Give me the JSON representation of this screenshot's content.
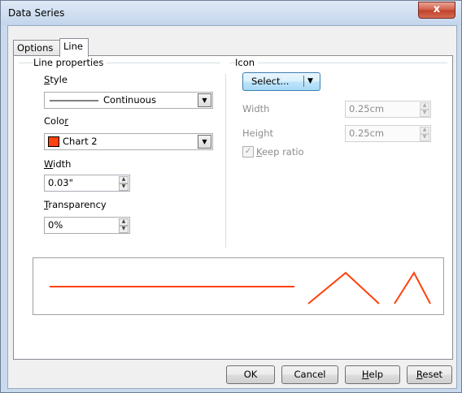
{
  "window": {
    "title": "Data Series",
    "close_label": "x"
  },
  "tabs": [
    {
      "label": "Options"
    },
    {
      "label": "Line"
    }
  ],
  "line_properties": {
    "group_label": "Line properties",
    "style": {
      "label": "Style",
      "value": "Continuous"
    },
    "color": {
      "label": "Color",
      "value": "Chart 2",
      "swatch": "#ff420e"
    },
    "width": {
      "label": "Width",
      "value": "0.03\""
    },
    "transparency": {
      "label": "Transparency",
      "value": "0%"
    }
  },
  "icon": {
    "group_label": "Icon",
    "select_label": "Select...",
    "width": {
      "label": "Width",
      "value": "0.25cm"
    },
    "height": {
      "label": "Height",
      "value": "0.25cm"
    },
    "keep_ratio": {
      "label": "Keep ratio",
      "checked": true
    }
  },
  "preview": {
    "line_color": "#ff420e"
  },
  "buttons": {
    "ok": "OK",
    "cancel": "Cancel",
    "help": "Help",
    "reset": "Reset"
  }
}
